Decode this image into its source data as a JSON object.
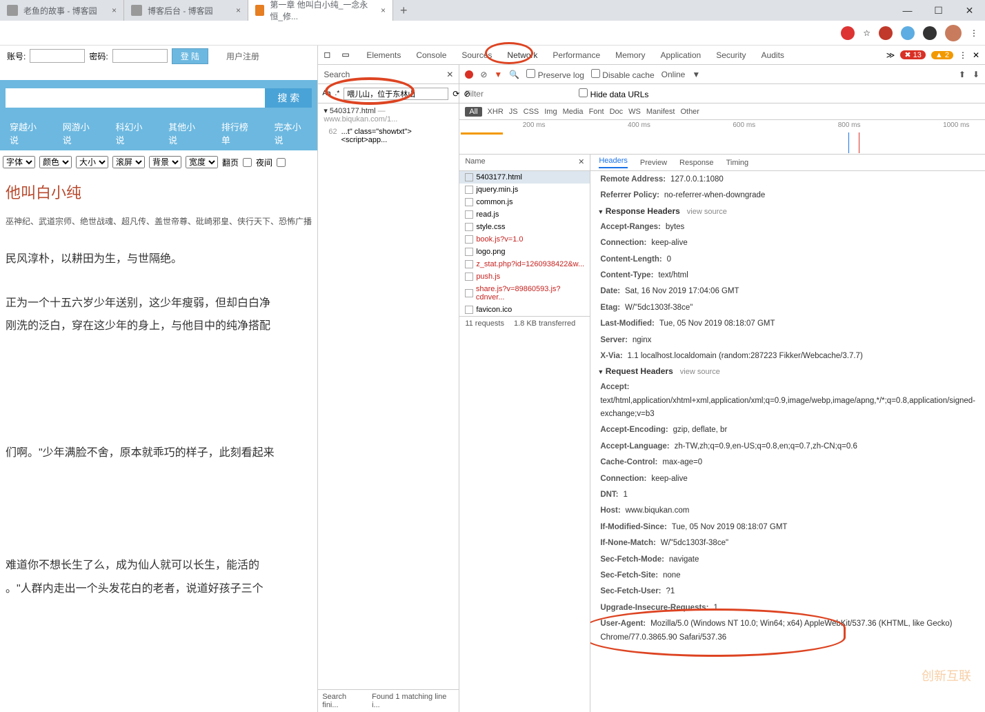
{
  "tabs": [
    {
      "title": "老鱼的故事 - 博客园"
    },
    {
      "title": "博客后台 - 博客园"
    },
    {
      "title": "第一章 他叫白小纯_一念永恒_修..."
    }
  ],
  "login": {
    "acct": "账号:",
    "pwd": "密码:",
    "btn": "登 陆",
    "reg": "用户注册"
  },
  "search": {
    "btn": "搜 索"
  },
  "nav": [
    "穿越小说",
    "网游小说",
    "科幻小说",
    "其他小说",
    "排行榜单",
    "完本小说"
  ],
  "toolbar": {
    "font": "字体",
    "color": "颜色",
    "size": "大小",
    "scroll": "滚屏",
    "bg": "背景",
    "width": "宽度",
    "page": "翻页",
    "night": "夜间"
  },
  "chapter": {
    "title": "他叫白小纯",
    "tags": "巫神纪、武道宗师、绝世战魂、超凡传、盖世帝尊、砒崎邪皇、侠行天下、恐怖广播",
    "p1": "民风淳朴，以耕田为生，与世隔绝。",
    "p2": "正为一个十五六岁少年送别，这少年瘦弱，但却白白净",
    "p3": "刚洗的泛白，穿在这少年的身上，与他目中的纯净搭配",
    "p4": "们啊。\"少年满脸不舍，原本就乖巧的样子，此刻看起来",
    "p5": "难道你不想长生了么，成为仙人就可以长生，能活的",
    "p6": "。\"人群内走出一个头发花白的老者，说道好孩子三个"
  },
  "devtabs": [
    "Elements",
    "Console",
    "Sources",
    "Network",
    "Performance",
    "Memory",
    "Application",
    "Security",
    "Audits"
  ],
  "errors": "13",
  "warnings": "2",
  "netbar": {
    "preserve": "Preserve log",
    "cache": "Disable cache",
    "online": "Online"
  },
  "filter": {
    "placeholder": "Filter",
    "hide": "Hide data URLs"
  },
  "types": [
    "All",
    "XHR",
    "JS",
    "CSS",
    "Img",
    "Media",
    "Font",
    "Doc",
    "WS",
    "Manifest",
    "Other"
  ],
  "ticks": [
    "200 ms",
    "400 ms",
    "600 ms",
    "800 ms",
    "1000 ms"
  ],
  "search_panel": {
    "label": "Search",
    "input": "喂儿山，位于东林山",
    "file": "5403177.html",
    "fileurl": "— www.biqukan.com/1...",
    "lineNum": "62",
    "lineTxt": "...t\" class=\"showtxt\"><script>app...",
    "ft1": "Search fini...",
    "ft2": "Found 1 matching line i..."
  },
  "reqHeader": "Name",
  "requests": [
    {
      "name": "5403177.html",
      "sel": true
    },
    {
      "name": "jquery.min.js"
    },
    {
      "name": "common.js"
    },
    {
      "name": "read.js"
    },
    {
      "name": "style.css"
    },
    {
      "name": "book.js?v=1.0",
      "red": true
    },
    {
      "name": "logo.png"
    },
    {
      "name": "z_stat.php?id=1260938422&w...",
      "red": true
    },
    {
      "name": "push.js",
      "red": true
    },
    {
      "name": "share.js?v=89860593.js?cdnver...",
      "red": true
    },
    {
      "name": "favicon.ico"
    }
  ],
  "reqft": {
    "a": "11 requests",
    "b": "1.8 KB transferred"
  },
  "detail_tabs": [
    "Headers",
    "Preview",
    "Response",
    "Timing"
  ],
  "general": {
    "remote_k": "Remote Address:",
    "remote_v": "127.0.0.1:1080",
    "ref_k": "Referrer Policy:",
    "ref_v": "no-referrer-when-downgrade"
  },
  "resp_label": "Response Headers",
  "view_source": "view source",
  "resp": {
    "ar_k": "Accept-Ranges:",
    "ar_v": "bytes",
    "cn_k": "Connection:",
    "cn_v": "keep-alive",
    "cl_k": "Content-Length:",
    "cl_v": "0",
    "ct_k": "Content-Type:",
    "ct_v": "text/html",
    "dt_k": "Date:",
    "dt_v": "Sat, 16 Nov 2019 17:04:06 GMT",
    "et_k": "Etag:",
    "et_v": "W/\"5dc1303f-38ce\"",
    "lm_k": "Last-Modified:",
    "lm_v": "Tue, 05 Nov 2019 08:18:07 GMT",
    "sv_k": "Server:",
    "sv_v": "nginx",
    "xv_k": "X-Via:",
    "xv_v": "1.1 localhost.localdomain (random:287223 Fikker/Webcache/3.7.7)"
  },
  "req_label": "Request Headers",
  "req": {
    "ac_k": "Accept:",
    "ac_v": "text/html,application/xhtml+xml,application/xml;q=0.9,image/webp,image/apng,*/*;q=0.8,application/signed-exchange;v=b3",
    "ae_k": "Accept-Encoding:",
    "ae_v": "gzip, deflate, br",
    "al_k": "Accept-Language:",
    "al_v": "zh-TW,zh;q=0.9,en-US;q=0.8,en;q=0.7,zh-CN;q=0.6",
    "cc_k": "Cache-Control:",
    "cc_v": "max-age=0",
    "co_k": "Connection:",
    "co_v": "keep-alive",
    "dn_k": "DNT:",
    "dn_v": "1",
    "ho_k": "Host:",
    "ho_v": "www.biqukan.com",
    "im_k": "If-Modified-Since:",
    "im_v": "Tue, 05 Nov 2019 08:18:07 GMT",
    "in_k": "If-None-Match:",
    "in_v": "W/\"5dc1303f-38ce\"",
    "sm_k": "Sec-Fetch-Mode:",
    "sm_v": "navigate",
    "ss_k": "Sec-Fetch-Site:",
    "ss_v": "none",
    "su_k": "Sec-Fetch-User:",
    "su_v": "?1",
    "ui_k": "Upgrade-Insecure-Requests:",
    "ui_v": "1",
    "ua_k": "User-Agent:",
    "ua_v": "Mozilla/5.0 (Windows NT 10.0; Win64; x64) AppleWebKit/537.36 (KHTML, like Gecko) Chrome/77.0.3865.90 Safari/537.36"
  },
  "watermark": "创新互联"
}
